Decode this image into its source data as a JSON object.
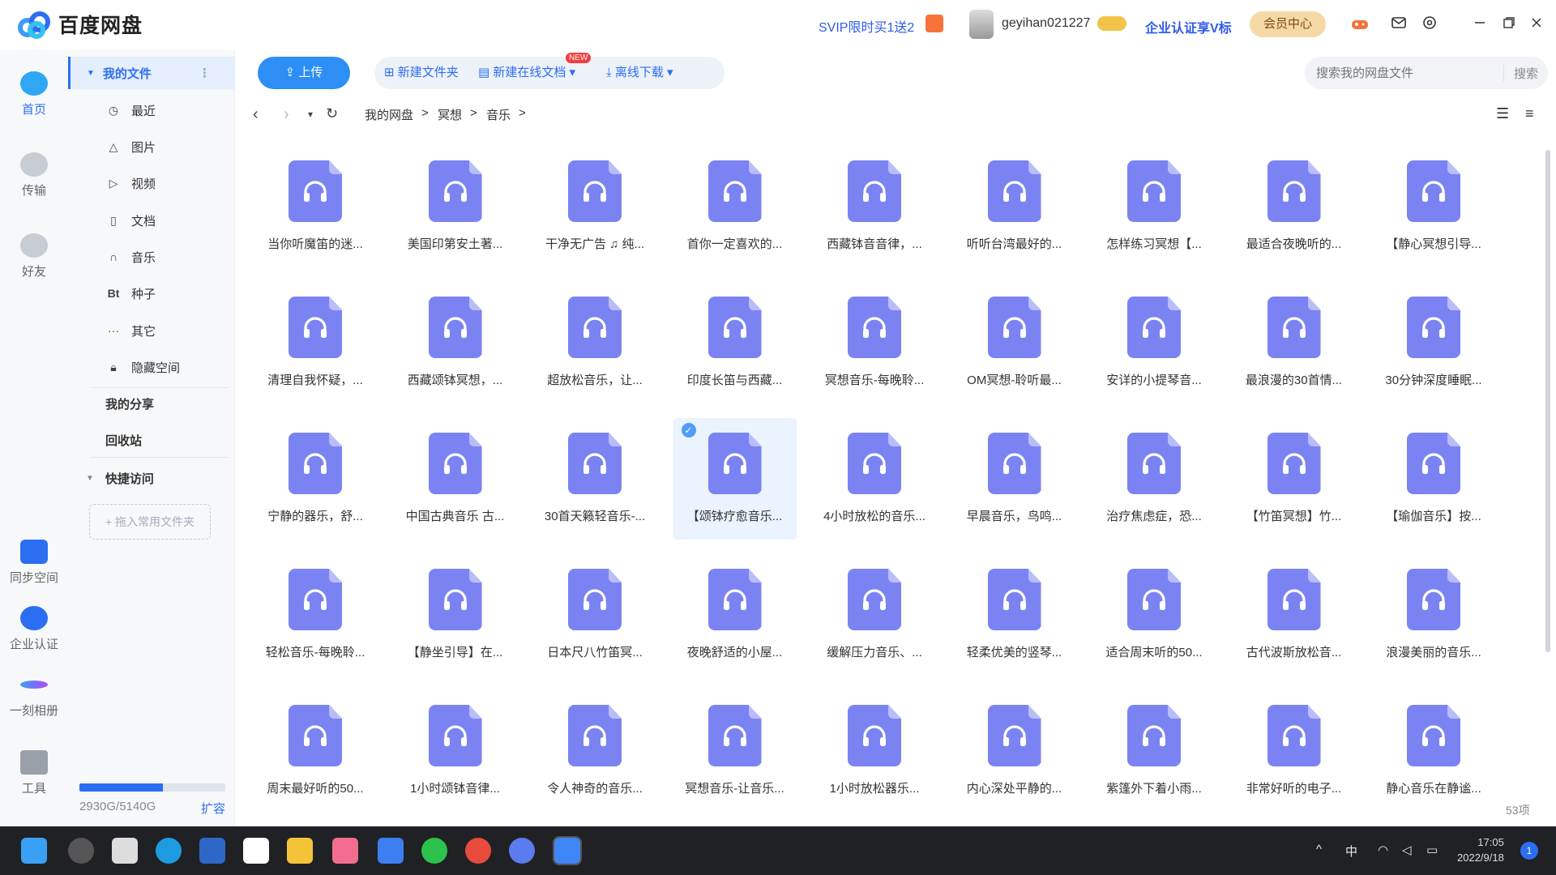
{
  "app": {
    "name": "百度网盘",
    "svip_promo": "SVIP限时买1送2",
    "username": "geyihan021227",
    "enterprise_promo": "企业认证享V标",
    "vip_center": "会员中心"
  },
  "rail": [
    {
      "label": "首页",
      "icon": "home-cloud-icon"
    },
    {
      "label": "传输",
      "icon": "transfer-icon"
    },
    {
      "label": "好友",
      "icon": "friends-icon"
    },
    {
      "label": "同步空间",
      "icon": "sync-space-icon"
    },
    {
      "label": "企业认证",
      "icon": "enterprise-verify-icon"
    },
    {
      "label": "一刻相册",
      "icon": "album-icon"
    },
    {
      "label": "工具",
      "icon": "tools-icon"
    }
  ],
  "sidebar": {
    "my_files": "我的文件",
    "items": [
      {
        "label": "最近",
        "icon": "clock-icon"
      },
      {
        "label": "图片",
        "icon": "image-icon"
      },
      {
        "label": "视频",
        "icon": "play-icon"
      },
      {
        "label": "文档",
        "icon": "document-icon"
      },
      {
        "label": "音乐",
        "icon": "headphones-icon"
      },
      {
        "label": "种子",
        "icon": "bt-icon"
      },
      {
        "label": "其它",
        "icon": "more-icon"
      },
      {
        "label": "隐藏空间",
        "icon": "lock-icon"
      }
    ],
    "my_share": "我的分享",
    "recycle": "回收站",
    "quick_access": "快捷访问",
    "add_folder": "+ 拖入常用文件夹",
    "storage_text": "2930G/5140G",
    "storage_used_fraction": 0.57,
    "expand": "扩容"
  },
  "toolbar": {
    "upload": "上传",
    "new_folder": "新建文件夹",
    "new_online_doc": "新建在线文档",
    "new_badge": "NEW",
    "offline_download": "离线下载",
    "search_placeholder": "搜索我的网盘文件",
    "search_button": "搜索"
  },
  "breadcrumb": [
    "我的网盘",
    "冥想",
    "音乐"
  ],
  "files": [
    "当你听魔笛的迷...",
    "美国印第安土著...",
    "干净无广告 ♫ 纯...",
    "首你一定喜欢的...",
    "西藏钵音音律，...",
    "听听台湾最好的...",
    "怎样练习冥想【...",
    "最适合夜晚听的...",
    "【静心冥想引导...",
    "清理自我怀疑，...",
    "西藏颂钵冥想，...",
    "超放松音乐，让...",
    "印度长笛与西藏...",
    "冥想音乐-每晚聆...",
    "OM冥想-聆听最...",
    "安详的小提琴音...",
    "最浪漫的30首情...",
    "30分钟深度睡眠...",
    "宁静的器乐，舒...",
    "中国古典音乐 古...",
    "30首天籁轻音乐-...",
    "【颂钵疗愈音乐...",
    "4小时放松的音乐...",
    "早晨音乐，鸟鸣...",
    "治疗焦虑症，恐...",
    "【竹笛冥想】竹...",
    "【瑜伽音乐】按...",
    "轻松音乐-每晚聆...",
    "【静坐引导】在...",
    "日本尺八竹笛冥...",
    "夜晚舒适的小屋...",
    "缓解压力音乐、...",
    "轻柔优美的竖琴...",
    "适合周末听的50...",
    "古代波斯放松音...",
    "浪漫美丽的音乐...",
    "周末最好听的50...",
    "1小时颂钵音律...",
    "令人神奇的音乐...",
    "冥想音乐-让音乐...",
    "1小时放松器乐...",
    "内心深处平静的...",
    "紫篷外下着小雨...",
    "非常好听的电子...",
    "静心音乐在静谧..."
  ],
  "selected_index": 21,
  "item_count": "53项",
  "taskbar": {
    "ime": "中",
    "time": "17:05",
    "date": "2022/9/18",
    "notifications": "1"
  },
  "colors": {
    "accent": "#2c6ef2",
    "file_icon": "#7b83f3",
    "upload_button": "#2d8ef5"
  }
}
